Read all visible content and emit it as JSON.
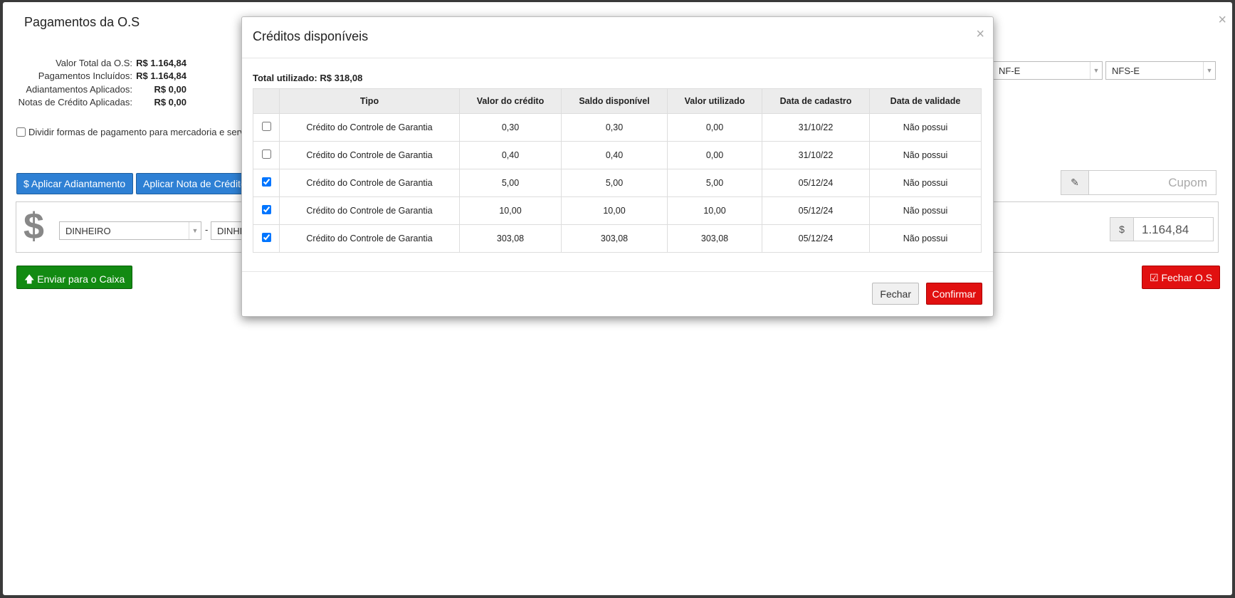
{
  "outer_modal": {
    "title": "Pagamentos da O.S",
    "close": "×",
    "summary": [
      {
        "label": "Valor Total da O.S:",
        "value": "R$ 1.164,84"
      },
      {
        "label": "Pagamentos Incluídos:",
        "value": "R$ 1.164,84"
      },
      {
        "label": "Adiantamentos Aplicados:",
        "value": "R$ 0,00"
      },
      {
        "label": "Notas de Crédito Aplicadas:",
        "value": "R$ 0,00"
      }
    ],
    "divide_label": "Dividir formas de pagamento para mercadoria e serv",
    "nf_select": "NF-E",
    "nfs_select": "NFS-E",
    "apply_advance_button": "$ Aplicar Adiantamento",
    "apply_credit_note_button": "Aplicar Nota de Crédito",
    "coupon_placeholder": "Cupom",
    "payment_method": "DINHEIRO",
    "payment_method_2": "DINHE",
    "separator": "-",
    "currency_symbol": "$",
    "amount_prefix": "$",
    "amount_value": "1.164,84",
    "send_to_cashier_button": "Enviar para o Caixa",
    "close_os_button": "Fechar O.S"
  },
  "credits_modal": {
    "title": "Créditos disponíveis",
    "close": "×",
    "total_used_label": "Total utilizado: R$ 318,08",
    "columns": [
      "Tipo",
      "Valor do crédito",
      "Saldo disponível",
      "Valor utilizado",
      "Data de cadastro",
      "Data de validade"
    ],
    "rows": [
      {
        "checked": false,
        "tipo": "Crédito do Controle de Garantia",
        "valor": "0,30",
        "saldo": "0,30",
        "utilizado": "0,00",
        "cadastro": "31/10/22",
        "validade": "Não possui"
      },
      {
        "checked": false,
        "tipo": "Crédito do Controle de Garantia",
        "valor": "0,40",
        "saldo": "0,40",
        "utilizado": "0,00",
        "cadastro": "31/10/22",
        "validade": "Não possui"
      },
      {
        "checked": true,
        "tipo": "Crédito do Controle de Garantia",
        "valor": "5,00",
        "saldo": "5,00",
        "utilizado": "5,00",
        "cadastro": "05/12/24",
        "validade": "Não possui"
      },
      {
        "checked": true,
        "tipo": "Crédito do Controle de Garantia",
        "valor": "10,00",
        "saldo": "10,00",
        "utilizado": "10,00",
        "cadastro": "05/12/24",
        "validade": "Não possui"
      },
      {
        "checked": true,
        "tipo": "Crédito do Controle de Garantia",
        "valor": "303,08",
        "saldo": "303,08",
        "utilizado": "303,08",
        "cadastro": "05/12/24",
        "validade": "Não possui"
      }
    ],
    "cancel_button": "Fechar",
    "confirm_button": "Confirmar"
  },
  "colors": {
    "primary_blue": "#2e80d4",
    "success_green": "#128a12",
    "danger_red": "#e11010"
  },
  "icons": [
    "dollar-icon",
    "arrow-up-icon",
    "check-square-icon",
    "ticket-icon",
    "close-icon",
    "caret-down-icon"
  ]
}
